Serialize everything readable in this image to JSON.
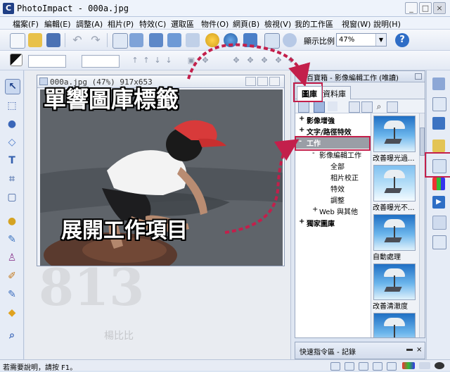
{
  "window": {
    "title": "PhotoImpact - 000a.jpg",
    "app_icon": "photoimpact-app-icon",
    "controls": [
      "minimize",
      "maximize",
      "close"
    ]
  },
  "menu": [
    "檔案(F)",
    "編輯(E)",
    "調整(A)",
    "相片(P)",
    "特效(C)",
    "選取區",
    "物件(O)",
    "網頁(B)",
    "檢視(V)",
    "我的工作區",
    "視窗(W)",
    "說明(H)"
  ],
  "toolbar": {
    "zoom_label": "顯示比例",
    "zoom_value": "47%",
    "help_icon": "help-icon",
    "help_glyph": "?"
  },
  "document": {
    "title": "000a.jpg (47%) 917x653"
  },
  "annotations": {
    "top": "單響圖庫標籤",
    "bottom": "展開工作項目"
  },
  "library": {
    "title": "百寶箱 - 影像編輯工作 (唯讀)",
    "tabs": [
      "圖庫",
      "資料庫"
    ],
    "tree": [
      {
        "label": "影像增強",
        "level": 0,
        "expander": "+"
      },
      {
        "label": "文字/路徑特效",
        "level": 0,
        "expander": "+"
      },
      {
        "label": "工作",
        "level": 0,
        "expander": "-",
        "selected": true
      },
      {
        "label": "影像編輯工作",
        "level": 1,
        "expander": "-"
      },
      {
        "label": "全部",
        "level": 2
      },
      {
        "label": "相片校正",
        "level": 2
      },
      {
        "label": "特效",
        "level": 2
      },
      {
        "label": "調整",
        "level": 2
      },
      {
        "label": "Web 與其他",
        "level": 1,
        "expander": "+"
      },
      {
        "label": "獨家圖庫",
        "level": 0,
        "expander": "+"
      }
    ],
    "thumbnails": [
      {
        "label": "改善曝光過..."
      },
      {
        "label": "改善曝光不..."
      },
      {
        "label": "自動處理"
      },
      {
        "label": "改善清澈度"
      },
      {
        "label": ""
      }
    ]
  },
  "quick_command": {
    "label": "快速指令區 - 記錄"
  },
  "watermark": {
    "text": "813",
    "signature": "楊比比"
  },
  "status": {
    "text": "若需要說明，請按 F1。"
  },
  "colors": {
    "highlight": "#c31f4b",
    "arrow": "#c31f4b",
    "selection": "#9a9ea6"
  }
}
